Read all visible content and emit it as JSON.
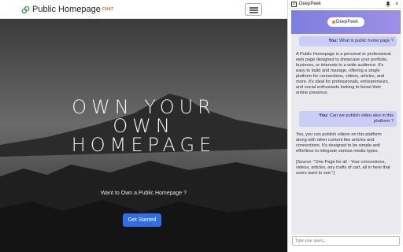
{
  "site": {
    "brand": "Public Homepage",
    "brand_sub": "CHAT",
    "headline_lines": [
      "OWN YOUR",
      "OWN",
      "HOMEPAGE"
    ],
    "subline": "Want to Own a Public Homepage ?",
    "cta": "Get Started"
  },
  "panel": {
    "logo": "D",
    "title": "DeepPeek",
    "close": "×",
    "header_pill": "DeepPeek",
    "messages": [
      {
        "role": "user",
        "label": "You:",
        "text": "What is public home page ?"
      },
      {
        "role": "bot",
        "paragraphs": [
          "A Public Homepage is a personal or professional web page designed to showcase your portfolio, business, or interests to a wide audience. It's easy to build and manage, offering a single platform for connections, videos, articles, and more. It's ideal for professionals, entrepreneurs, and social enthusiasts looking to boost their online presence."
        ]
      },
      {
        "role": "user",
        "label": "You:",
        "text": "Can we publish video also in this platform ?"
      },
      {
        "role": "bot",
        "paragraphs": [
          "Yes, you can publish videos on this platform along with other content like articles and connections. It's designed to be simple and effortless to integrate various media types.",
          "[Source: \"One Page for all - Your connections, videos, articles, any crafts of cart, all in here that users want to see.\"]"
        ]
      }
    ],
    "input_placeholder": "Type your query..."
  },
  "colors": {
    "cta": "#2f6ee6",
    "brand_sub": "#e86a1a",
    "chat_header": "#8a86e3",
    "user_bubble": "#c9cdf7"
  }
}
